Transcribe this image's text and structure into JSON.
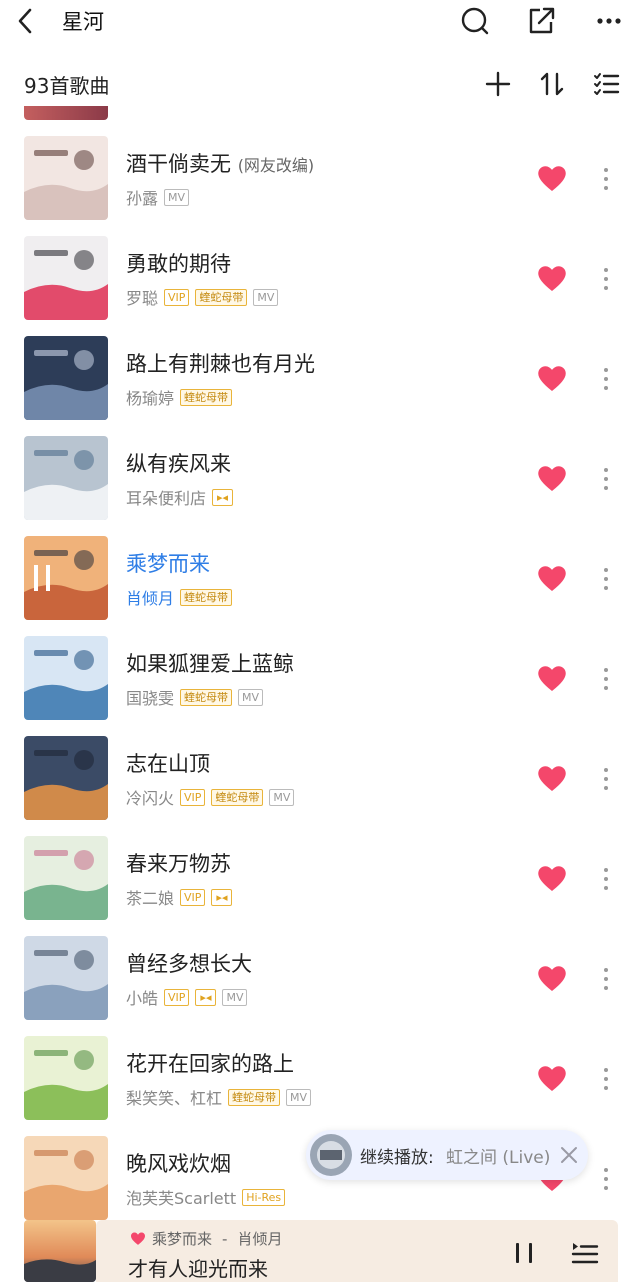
{
  "header": {
    "title": "星河"
  },
  "subheader": {
    "count": "93首歌曲"
  },
  "songs": [
    {
      "title": "酒干倘卖无",
      "note": "(网友改编)",
      "artist": "孙露",
      "badges": [
        "MV"
      ],
      "liked": true,
      "playing": false
    },
    {
      "title": "勇敢的期待",
      "note": "",
      "artist": "罗聪",
      "badges": [
        "VIP",
        "蝰蛇母带",
        "MV"
      ],
      "liked": true,
      "playing": false
    },
    {
      "title": "路上有荆棘也有月光",
      "note": "",
      "artist": "杨瑜婷",
      "badges": [
        "蝰蛇母带"
      ],
      "liked": true,
      "playing": false
    },
    {
      "title": "纵有疾风来",
      "note": "",
      "artist": "耳朵便利店",
      "badges": [
        "杜比"
      ],
      "liked": true,
      "playing": false
    },
    {
      "title": "乘梦而来",
      "note": "",
      "artist": "肖倾月",
      "badges": [
        "蝰蛇母带"
      ],
      "liked": true,
      "playing": true
    },
    {
      "title": "如果狐狸爱上蓝鲸",
      "note": "",
      "artist": "国骁雯",
      "badges": [
        "蝰蛇母带",
        "MV"
      ],
      "liked": true,
      "playing": false
    },
    {
      "title": "志在山顶",
      "note": "",
      "artist": "冷闪火",
      "badges": [
        "VIP",
        "蝰蛇母带",
        "MV"
      ],
      "liked": true,
      "playing": false
    },
    {
      "title": "春来万物苏",
      "note": "",
      "artist": "茶二娘",
      "badges": [
        "VIP",
        "杜比"
      ],
      "liked": true,
      "playing": false
    },
    {
      "title": "曾经多想长大",
      "note": "",
      "artist": "小皓",
      "badges": [
        "VIP",
        "杜比",
        "MV"
      ],
      "liked": true,
      "playing": false
    },
    {
      "title": "花开在回家的路上",
      "note": "",
      "artist": "梨笑笑、杠杠",
      "badges": [
        "蝰蛇母带",
        "MV"
      ],
      "liked": true,
      "playing": false
    },
    {
      "title": "晚风戏炊烟",
      "note": "",
      "artist": "泡芙芙Scarlett",
      "badges": [
        "Hi-Res"
      ],
      "liked": true,
      "playing": false
    }
  ],
  "toast": {
    "label": "继续播放:",
    "value": "虹之间 (Live)"
  },
  "player": {
    "song": "乘梦而来",
    "separator": "-",
    "artist": "肖倾月",
    "lyric": "才有人迎光而来"
  },
  "colors": {
    "accent": "#2f7ee6",
    "heart": "#f4476b",
    "gold": "#e0a320"
  }
}
